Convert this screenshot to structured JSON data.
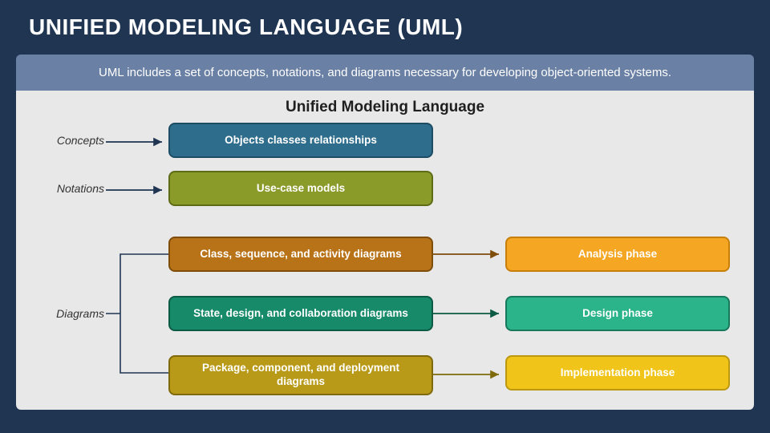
{
  "title": "UNIFIED MODELING LANGUAGE (UML)",
  "subtitle": "UML includes a set of concepts, notations, and diagrams necessary for developing object-oriented systems.",
  "panel_heading": "Unified Modeling Language",
  "labels": {
    "concepts": "Concepts",
    "notations": "Notations",
    "diagrams": "Diagrams"
  },
  "boxes": {
    "concepts": "Objects classes relationships",
    "notations": "Use-case models",
    "diagram1": "Class, sequence, and activity diagrams",
    "diagram2": "State, design, and collaboration diagrams",
    "diagram3": "Package, component, and deployment diagrams"
  },
  "phases": {
    "analysis": "Analysis phase",
    "design": "Design phase",
    "implementation": "Implementation phase"
  }
}
